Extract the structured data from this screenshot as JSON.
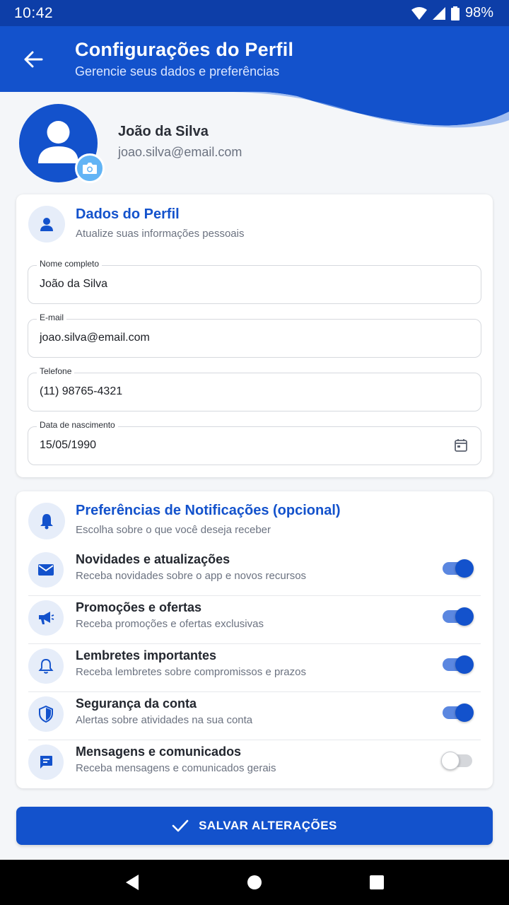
{
  "status_bar": {
    "time": "10:42",
    "battery": "98%"
  },
  "app_bar": {
    "title": "Configurações do Perfil",
    "subtitle": "Gerencie seus dados e preferências"
  },
  "profile": {
    "name": "João da Silva",
    "email": "joao.silva@email.com"
  },
  "profile_card": {
    "title": "Dados do Perfil",
    "subtitle": "Atualize suas informações pessoais",
    "fields": [
      {
        "label": "Nome completo",
        "value": "João da Silva"
      },
      {
        "label": "E-mail",
        "value": "joao.silva@email.com"
      },
      {
        "label": "Telefone",
        "value": "(11) 98765-4321"
      },
      {
        "label": "Data de nascimento",
        "value": "15/05/1990",
        "icon": "calendar-icon"
      }
    ]
  },
  "notifications_card": {
    "title": "Preferências de Notificações (opcional)",
    "subtitle": "Escolha sobre o que você deseja receber",
    "items": [
      {
        "title": "Novidades e atualizações",
        "description": "Receba novidades sobre o app e novos recursos",
        "icon": "mail-icon",
        "enabled": true
      },
      {
        "title": "Promoções e ofertas",
        "description": "Receba promoções e ofertas exclusivas",
        "icon": "megaphone-icon",
        "enabled": true
      },
      {
        "title": "Lembretes importantes",
        "description": "Receba lembretes sobre compromissos e prazos",
        "icon": "bell-icon",
        "enabled": true
      },
      {
        "title": "Segurança da conta",
        "description": "Alertas sobre atividades na sua conta",
        "icon": "shield-icon",
        "enabled": true
      },
      {
        "title": "Mensagens e comunicados",
        "description": "Receba mensagens e comunicados gerais",
        "icon": "message-icon",
        "enabled": false
      }
    ]
  },
  "save_button": {
    "label": "SALVAR ALTERAÇÕES"
  },
  "colors": {
    "primary": "#1352cc",
    "accent_light": "#62b4f5",
    "toggle_track_on": "#5b87e0"
  }
}
